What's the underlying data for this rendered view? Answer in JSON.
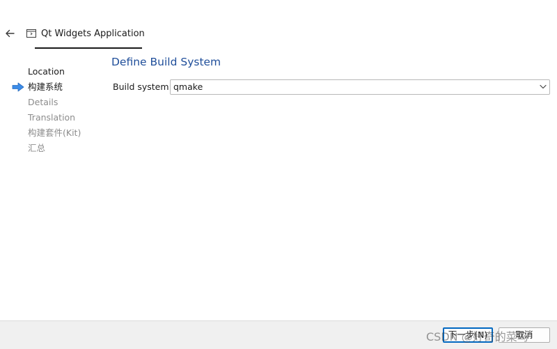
{
  "header": {
    "title": "Qt Widgets Application",
    "back_icon": "arrow-left-icon",
    "app_icon": "qt-window-icon"
  },
  "sidebar": {
    "items": [
      {
        "label": "Location",
        "state": "done"
      },
      {
        "label": "构建系统",
        "state": "current"
      },
      {
        "label": "Details",
        "state": "pending"
      },
      {
        "label": "Translation",
        "state": "pending"
      },
      {
        "label": "构建套件(Kit)",
        "state": "pending"
      },
      {
        "label": "汇总",
        "state": "pending"
      }
    ],
    "current_marker_icon": "arrow-right-icon"
  },
  "main": {
    "page_title": "Define Build System",
    "build_system": {
      "label": "Build system:",
      "value": "qmake"
    }
  },
  "footer": {
    "next_label": "下一步(N)",
    "cancel_label": "取消"
  },
  "watermark": "CSDN @好奇的菜鸟",
  "colors": {
    "title_blue": "#1f4e9a",
    "arrow_blue": "#3c8ce8",
    "pending_gray": "#8c8c8c",
    "footer_bg": "#f0f0f0",
    "focus_blue": "#0067c0"
  }
}
